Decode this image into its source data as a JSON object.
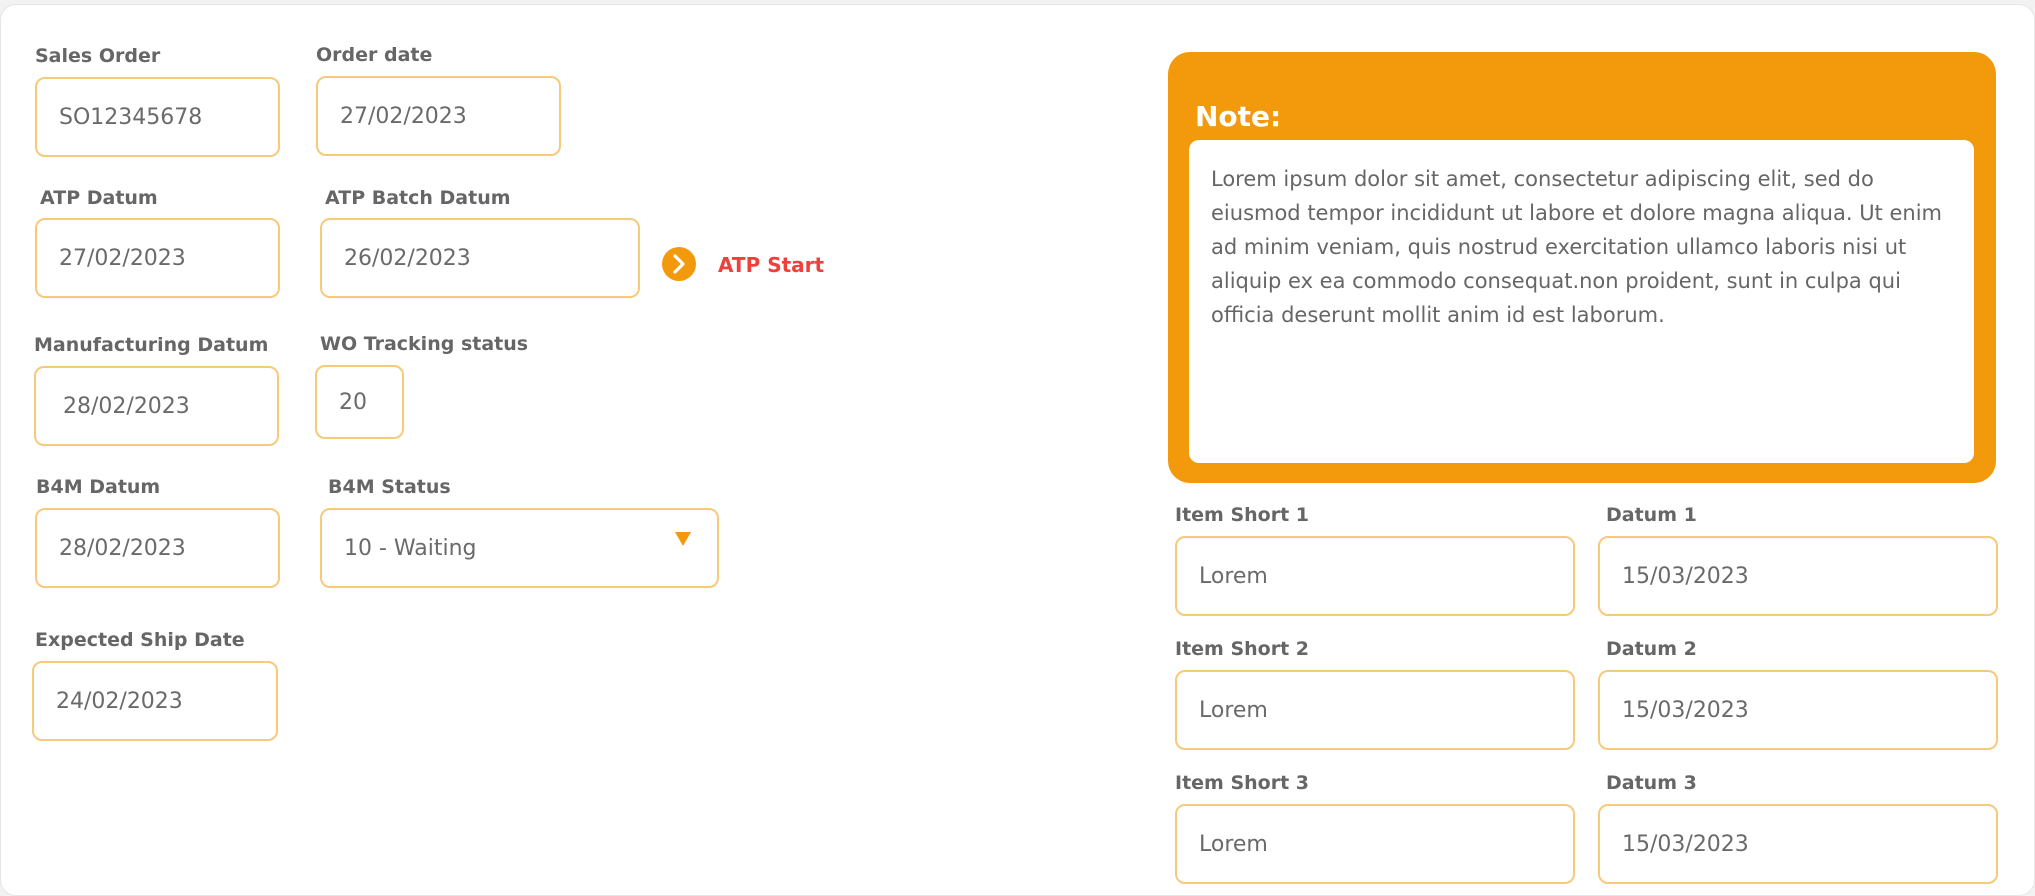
{
  "form": {
    "sales_order": {
      "label": "Sales Order",
      "value": "SO12345678"
    },
    "order_date": {
      "label": "Order date",
      "value": "27/02/2023"
    },
    "atp_datum": {
      "label": "ATP Datum",
      "value": "27/02/2023"
    },
    "atp_batch_datum": {
      "label": "ATP Batch Datum",
      "value": "26/02/2023"
    },
    "atp_start": {
      "label": "ATP Start",
      "icon": "chevron-right-icon"
    },
    "manufacturing_datum": {
      "label": "Manufacturing Datum",
      "value": "28/02/2023"
    },
    "wo_tracking_status": {
      "label": "WO Tracking status",
      "value": "20"
    },
    "b4m_datum": {
      "label": "B4M Datum",
      "value": "28/02/2023"
    },
    "b4m_status": {
      "label": "B4M Status",
      "value": "10 - Waiting",
      "icon": "caret-down-icon"
    },
    "expected_ship_date": {
      "label": "Expected Ship Date",
      "value": "24/02/2023"
    }
  },
  "note": {
    "title": "Note:",
    "text": "Lorem ipsum dolor sit amet, consectetur adipiscing elit, sed do eiusmod tempor incididunt ut labore et dolore magna aliqua. Ut enim ad minim veniam, quis nostrud exercitation ullamco laboris nisi ut aliquip ex ea commodo consequat.non proident, sunt in culpa qui officia deserunt mollit anim id est laborum."
  },
  "items": [
    {
      "item_label": "Item Short 1",
      "item_value": "Lorem",
      "datum_label": "Datum 1",
      "datum_value": "15/03/2023"
    },
    {
      "item_label": "Item Short 2",
      "item_value": "Lorem",
      "datum_label": "Datum 2",
      "datum_value": "15/03/2023"
    },
    {
      "item_label": "Item Short 3",
      "item_value": "Lorem",
      "datum_label": "Datum 3",
      "datum_value": "15/03/2023"
    }
  ],
  "colors": {
    "accent": "#f29a0c",
    "field_border": "#f7c97a",
    "atp_start_text": "#f0403d",
    "label_text": "#666666"
  }
}
